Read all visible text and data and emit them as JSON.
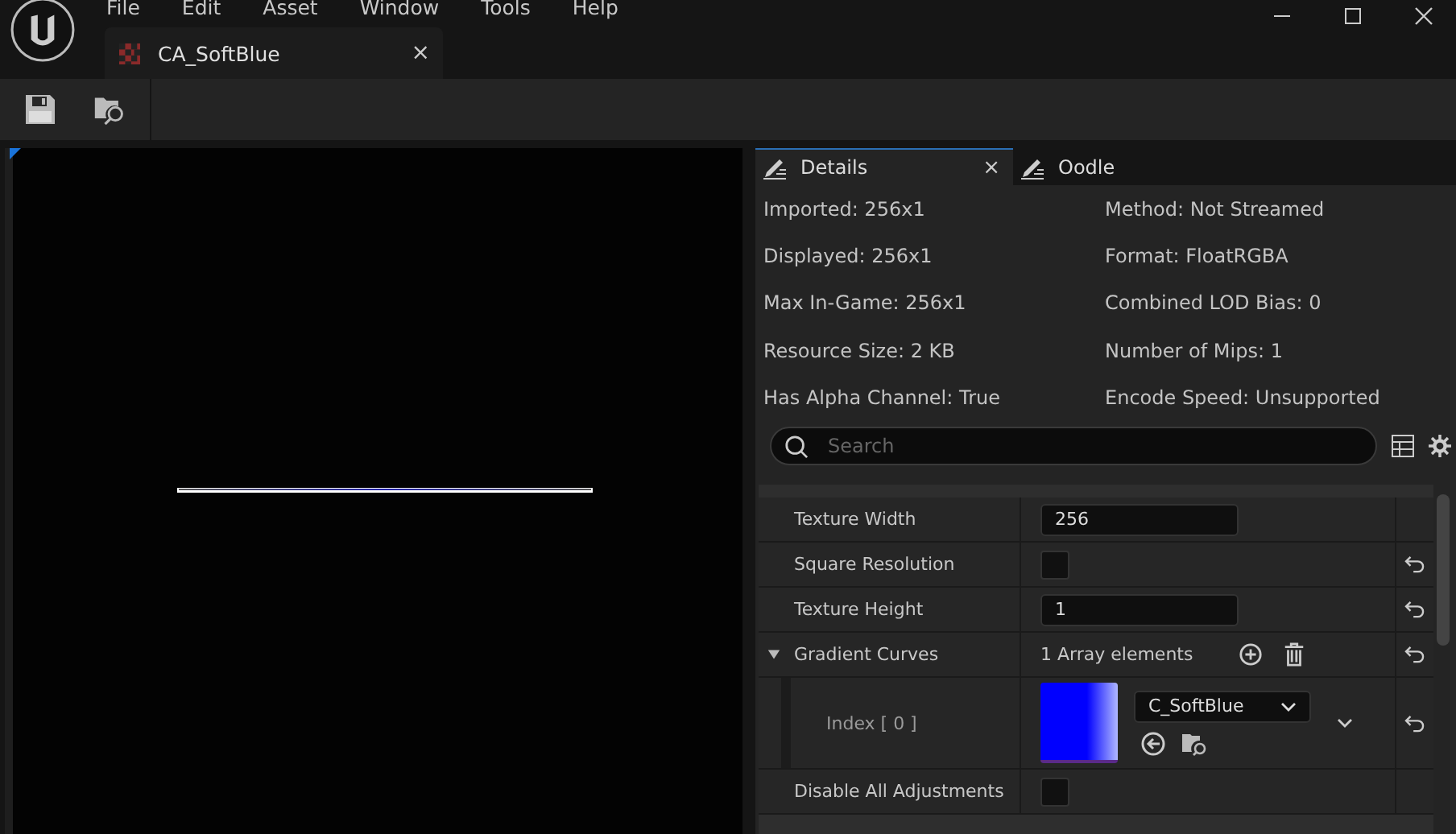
{
  "menu": [
    "File",
    "Edit",
    "Asset",
    "Window",
    "Tools",
    "Help"
  ],
  "document_tab": {
    "title": "CA_SoftBlue",
    "close": "×"
  },
  "details_tabs": [
    {
      "label": "Details",
      "close": "×",
      "selected": true
    },
    {
      "label": "Oodle",
      "selected": false
    }
  ],
  "info": [
    [
      "Imported: 256x1",
      "Method: Not Streamed"
    ],
    [
      "Displayed: 256x1",
      "Format: FloatRGBA"
    ],
    [
      "Max In-Game: 256x1",
      "Combined LOD Bias: 0"
    ],
    [
      "Resource Size: 2 KB",
      "Number of Mips: 1"
    ],
    [
      "Has Alpha Channel: True",
      "Encode Speed: Unsupported"
    ]
  ],
  "search": {
    "placeholder": "Search"
  },
  "properties": [
    {
      "kind": "text",
      "name": "Texture Width",
      "value": "256",
      "reset": false
    },
    {
      "kind": "checkbox",
      "name": "Square Resolution",
      "checked": false,
      "reset": true
    },
    {
      "kind": "text",
      "name": "Texture Height",
      "value": "1",
      "reset": true
    },
    {
      "kind": "array",
      "name": "Gradient Curves",
      "expanded": true,
      "value": "1 Array elements",
      "reset": true
    },
    {
      "kind": "element",
      "name": "Index [ 0 ]",
      "asset": "C_SoftBlue",
      "reset": true
    },
    {
      "kind": "checkbox",
      "name": "Disable All Adjustments",
      "checked": false,
      "reset": false
    }
  ]
}
